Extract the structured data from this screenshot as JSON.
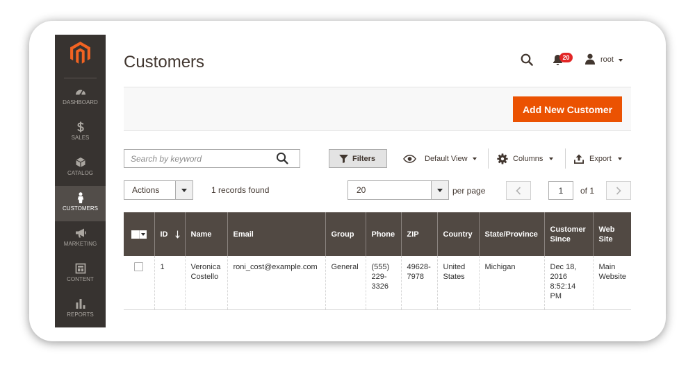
{
  "sidebar": {
    "logo_icon": "magento-logo-icon",
    "items": [
      {
        "label": "DASHBOARD",
        "icon": "dashboard-icon"
      },
      {
        "label": "SALES",
        "icon": "dollar-icon"
      },
      {
        "label": "CATALOG",
        "icon": "cube-icon"
      },
      {
        "label": "CUSTOMERS",
        "icon": "person-icon",
        "active": true
      },
      {
        "label": "MARKETING",
        "icon": "megaphone-icon"
      },
      {
        "label": "CONTENT",
        "icon": "layout-icon"
      },
      {
        "label": "REPORTS",
        "icon": "bar-chart-icon"
      }
    ]
  },
  "header": {
    "title": "Customers",
    "search_icon": "search-icon",
    "notifications_icon": "bell-icon",
    "notifications_count": "20",
    "user_icon": "user-icon",
    "user_name": "root"
  },
  "actions": {
    "add_new_label": "Add New Customer"
  },
  "toolbar": {
    "search_placeholder": "Search by keyword",
    "filters_label": "Filters",
    "view_label": "Default View",
    "columns_label": "Columns",
    "export_label": "Export",
    "mass_actions_label": "Actions",
    "records_found": "1 records found",
    "per_page_value": "20",
    "per_page_label": "per page",
    "current_page": "1",
    "total_pages_label": "of 1"
  },
  "grid": {
    "sort_icon": "arrow-down-icon",
    "columns": [
      "ID",
      "Name",
      "Email",
      "Group",
      "Phone",
      "ZIP",
      "Country",
      "State/Province",
      "Customer Since",
      "Web Site"
    ],
    "rows": [
      {
        "id": "1",
        "name": "Veronica Costello",
        "email": "roni_cost@example.com",
        "group": "General",
        "phone": "(555) 229-3326",
        "zip": "49628-7978",
        "country": "United States",
        "state": "Michigan",
        "customer_since": "Dec 18, 2016 8:52:14 PM",
        "website": "Main Website"
      }
    ]
  },
  "colors": {
    "accent": "#eb5202",
    "logo": "#f26322",
    "sidebar": "#373330",
    "sidebar_active": "#524d49",
    "grid_header": "#514943",
    "badge": "#e22626",
    "text": "#41362f"
  }
}
